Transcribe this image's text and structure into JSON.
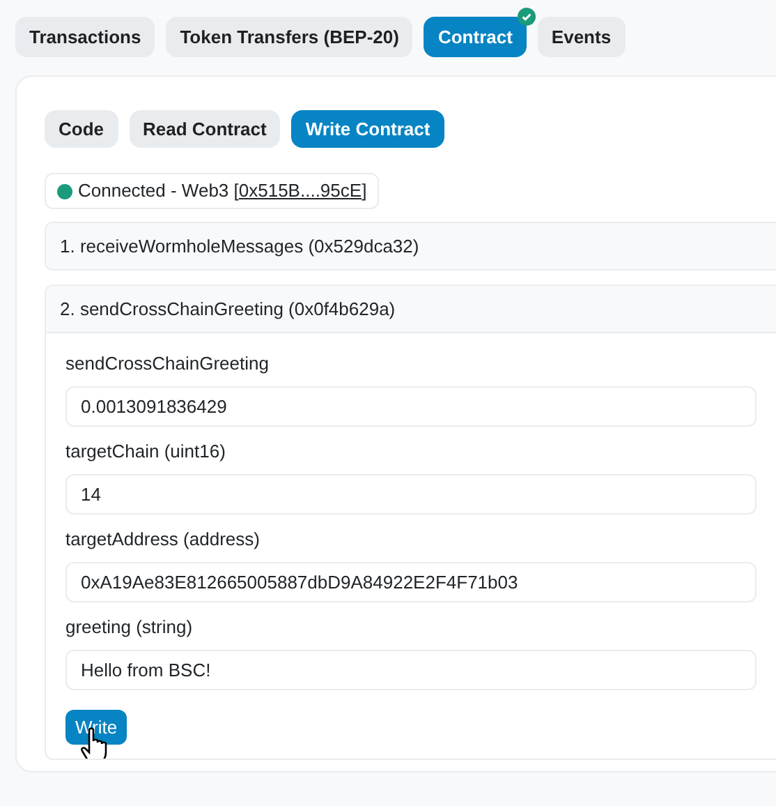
{
  "tabs": [
    {
      "label": "Transactions",
      "selected": false,
      "verified": false
    },
    {
      "label": "Token Transfers (BEP-20)",
      "selected": false,
      "verified": false
    },
    {
      "label": "Contract",
      "selected": true,
      "verified": true
    },
    {
      "label": "Events",
      "selected": false,
      "verified": false
    }
  ],
  "subtabs": [
    {
      "label": "Code",
      "selected": false
    },
    {
      "label": "Read Contract",
      "selected": false
    },
    {
      "label": "Write Contract",
      "selected": true
    }
  ],
  "connection": {
    "connected": true,
    "text": "Connected - Web3 [",
    "address": "0x515B....95cE",
    "suffix": "]"
  },
  "functions": [
    {
      "title": "1. receiveWormholeMessages (0x529dca32)",
      "expanded": false
    },
    {
      "title": "2. sendCrossChainGreeting (0x0f4b629a)",
      "expanded": true,
      "fields": [
        {
          "label": "sendCrossChainGreeting",
          "value": "0.0013091836429"
        },
        {
          "label": "targetChain (uint16)",
          "value": "14"
        },
        {
          "label": "targetAddress (address)",
          "value": "0xA19Ae83E812665005887dbD9A84922E2F4F71b03"
        },
        {
          "label": "greeting (string)",
          "value": "Hello from BSC!"
        }
      ],
      "button": "Write"
    }
  ]
}
